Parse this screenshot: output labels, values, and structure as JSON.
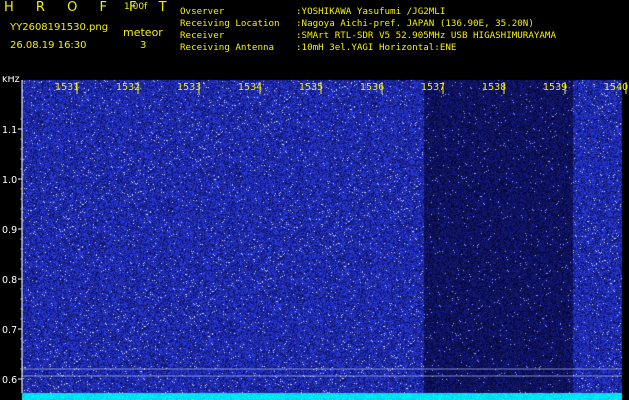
{
  "header": {
    "app_title": "H R O F F T",
    "version": "1.00f",
    "filename": "YY2608191530.png",
    "datetime": "26.08.19 16:30",
    "meteor_label": "meteor",
    "meteor_count": "3"
  },
  "info": [
    {
      "key": "Ovserver",
      "value": ":YOSHIKAWA Yasufumi /JG2MLI"
    },
    {
      "key": "Receiving Location",
      "value": ":Nagoya Aichi-pref. JAPAN (136.90E, 35.20N)"
    },
    {
      "key": "Receiver",
      "value": ":SMArt RTL-SDR V5 52.905MHz USB HIGASHIMURAYAMA"
    },
    {
      "key": "Receiving Antenna",
      "value": ":10mH 3el.YAGI Horizontal:ENE"
    }
  ],
  "plot": {
    "y_unit": "kHz",
    "y_ticks": [
      "1.1",
      "1.0",
      "0.9",
      "0.8",
      "0.7",
      "0.6"
    ],
    "y_tick_values": [
      1.1,
      1.0,
      0.9,
      0.8,
      0.7,
      0.6
    ],
    "x_ticks": [
      "1531",
      "1532",
      "1533",
      "1534",
      "1535",
      "1536",
      "1537",
      "1538",
      "1539",
      "1540"
    ],
    "colors": {
      "noise_bright": "#1f2cd8",
      "noise_dim": "#070a5e",
      "tick_label": "#f4f000",
      "axis_label": "#ffffff",
      "baseline": "#00e8ff"
    }
  }
}
